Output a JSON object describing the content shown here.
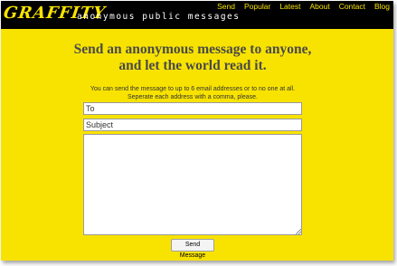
{
  "header": {
    "logo_text": "GRAFFITY",
    "tagline": "anonymous public messages",
    "nav": [
      {
        "label": "Send"
      },
      {
        "label": "Popular"
      },
      {
        "label": "Latest"
      },
      {
        "label": "About"
      },
      {
        "label": "Contact"
      },
      {
        "label": "Blog"
      }
    ]
  },
  "main": {
    "headline_line1": "Send an anonymous message to anyone,",
    "headline_line2": "and let the world read it.",
    "intro_line1": "You can send the message to up to 6 email addresses or to no one at all.",
    "intro_line2": "Seperate each address with a comma, please."
  },
  "form": {
    "to_placeholder": "To",
    "subject_placeholder": "Subject",
    "message_value": "",
    "send_label": "Send Message"
  },
  "colors": {
    "background": "#f8e300",
    "header": "#000000",
    "accent": "#f8e300"
  }
}
